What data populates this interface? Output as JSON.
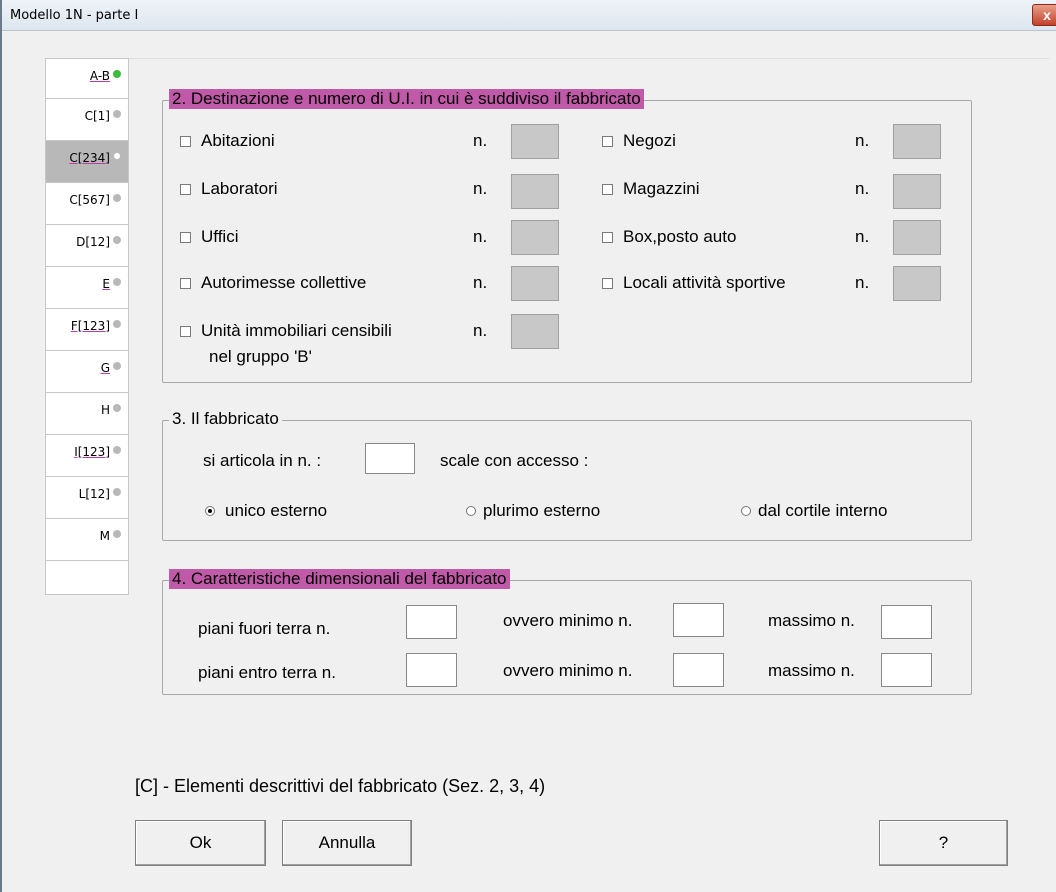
{
  "window": {
    "title": "Modello 1N  -   parte I",
    "close": "x"
  },
  "tabs": [
    {
      "label": "A-B",
      "status": "green",
      "active": false
    },
    {
      "label": "C[1]",
      "status": "grey",
      "active": false
    },
    {
      "label": "C[234]",
      "status": "white",
      "active": true
    },
    {
      "label": "C[567]",
      "status": "grey",
      "active": false
    },
    {
      "label": "D[12]",
      "status": "grey",
      "active": false
    },
    {
      "label": "E",
      "status": "grey",
      "active": false
    },
    {
      "label": "F[123]",
      "status": "grey",
      "active": false
    },
    {
      "label": "G",
      "status": "grey",
      "active": false
    },
    {
      "label": "H",
      "status": "grey",
      "active": false
    },
    {
      "label": "I[123]",
      "status": "grey",
      "active": false
    },
    {
      "label": "L[12]",
      "status": "grey",
      "active": false
    },
    {
      "label": "M",
      "status": "grey",
      "active": false
    }
  ],
  "section2": {
    "title": "2. Destinazione e numero di U.I. in cui è suddiviso il fabbricato",
    "n_label": "n.",
    "items": [
      {
        "label": "Abitazioni"
      },
      {
        "label": "Laboratori"
      },
      {
        "label": "Uffici"
      },
      {
        "label": "Autorimesse collettive"
      },
      {
        "label": "Unità immobiliari censibili"
      },
      {
        "label": "Negozi"
      },
      {
        "label": "Magazzini"
      },
      {
        "label": "Box,posto auto"
      },
      {
        "label": "Locali attività sportive"
      }
    ],
    "item5_line2": "nel gruppo 'B'"
  },
  "section3": {
    "title": "3. Il fabbricato",
    "articola": "si articola in n. :",
    "scale": "scale con accesso :",
    "options": [
      "unico esterno",
      "plurimo esterno",
      "dal cortile interno"
    ],
    "selected": "unico esterno"
  },
  "section4": {
    "title": "4. Caratteristiche dimensionali del fabbricato",
    "row1": "piani fuori  terra n.",
    "row2": "piani entro terra n.",
    "ovvero": "ovvero minimo n.",
    "massimo": "massimo n."
  },
  "footer": {
    "title": "[C] - Elementi descrittivi del fabbricato (Sez. 2, 3, 4)",
    "ok": "Ok",
    "cancel": "Annulla",
    "help": "?"
  },
  "colors": {
    "accent_legend": "#c05aa8",
    "status_green": "#3cba3c"
  }
}
